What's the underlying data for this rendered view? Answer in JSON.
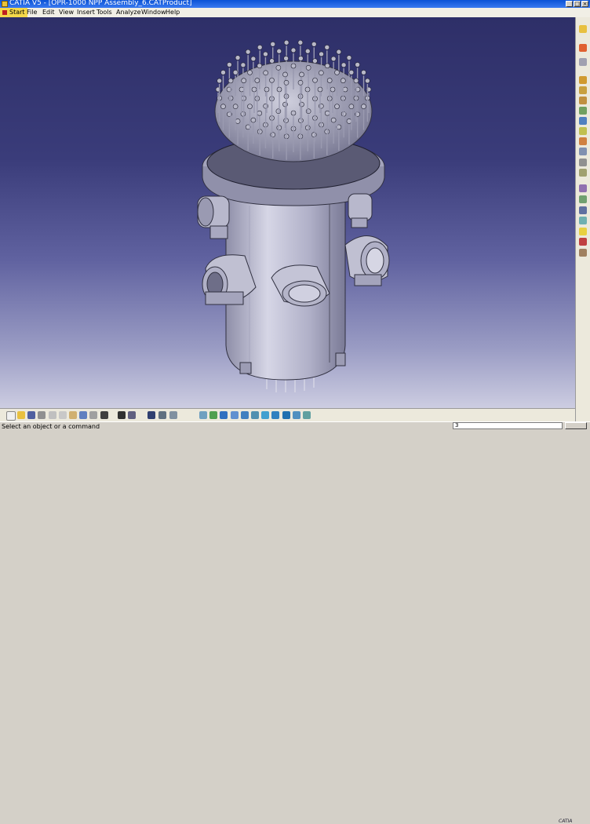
{
  "window": {
    "title": "CATIA V5 - [OPR-1000 NPP Assembly_6.CATProduct]",
    "minimize_glyph": "_",
    "maximize_glyph": "□",
    "close_glyph": "×"
  },
  "menubar": {
    "items": [
      "Start",
      "File",
      "Edit",
      "View",
      "Insert",
      "Tools",
      "Analyze",
      "Window",
      "Help"
    ]
  },
  "viewport": {
    "background_top": "#2e2f68",
    "background_bottom": "#d8d8e8",
    "model_color": "#b4b4cc"
  },
  "right_toolbar": {
    "icons": [
      "cursor-icon",
      "sketch-icon",
      "cube-icon",
      "product-icon",
      "component-icon",
      "part-icon",
      "insert-icon",
      "replace-icon",
      "graph-icon",
      "renumber-icon",
      "bom-icon",
      "manipulation-icon",
      "snap-icon",
      "explode-icon",
      "clash-icon",
      "catalog-icon",
      "scene-icon",
      "light-icon",
      "measure-icon",
      "annotation-icon"
    ]
  },
  "bottom_toolbar": {
    "icons": [
      "new-icon",
      "open-icon",
      "save-icon",
      "print-icon",
      "cut-icon",
      "copy-icon",
      "paste-icon",
      "undo-icon",
      "redo-icon",
      "whats-this-icon",
      "formula-icon",
      "comment-icon",
      "select-icon",
      "catalog-icon",
      "fly-icon",
      "fit-all-icon",
      "pan-icon",
      "rotate-icon",
      "zoom-in-icon",
      "zoom-out-icon",
      "normal-view-icon",
      "iso-view-icon",
      "shading-icon",
      "hide-show-icon",
      "swap-icon",
      "render-icon"
    ],
    "logo": "CATIA"
  },
  "statusbar": {
    "message": "Select an object or a command",
    "command_value": "3"
  }
}
